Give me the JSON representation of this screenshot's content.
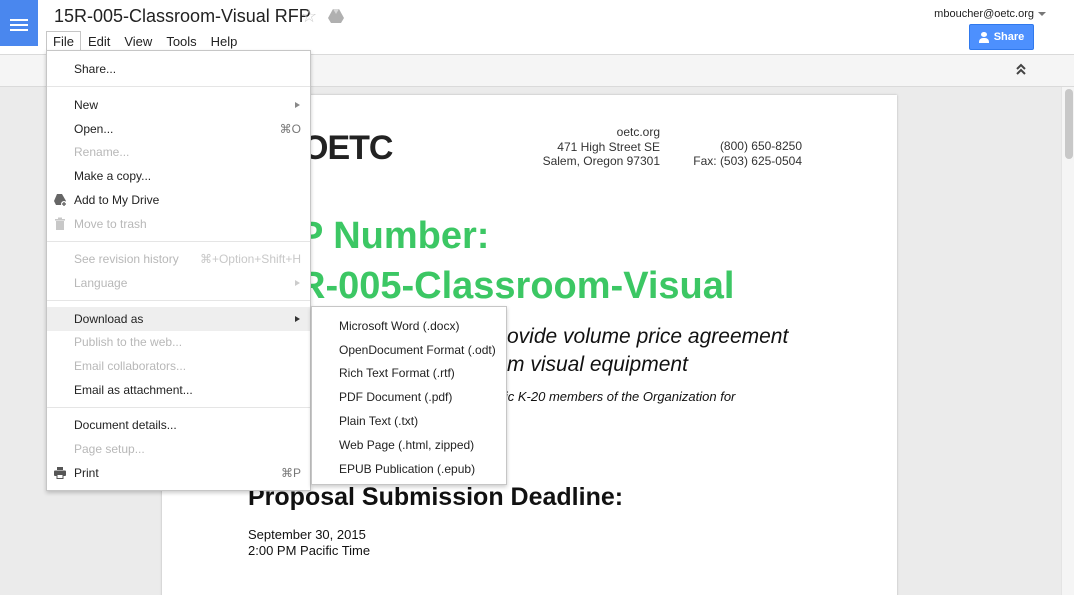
{
  "app": {
    "doc_title": "15R-005-Classroom-Visual RFP",
    "user_email": "mboucher@oetc.org",
    "share_label": "Share",
    "menubar": [
      "File",
      "Edit",
      "View",
      "Tools",
      "Help"
    ],
    "active_menu": "File"
  },
  "file_menu": {
    "items": [
      {
        "label": "Share...",
        "shortcut": "",
        "disabled": false,
        "submenu": false
      },
      {
        "label": "New",
        "shortcut": "",
        "disabled": false,
        "submenu": true
      },
      {
        "label": "Open...",
        "shortcut": "⌘O",
        "disabled": false,
        "submenu": false
      },
      {
        "label": "Rename...",
        "shortcut": "",
        "disabled": true,
        "submenu": false
      },
      {
        "label": "Make a copy...",
        "shortcut": "",
        "disabled": false,
        "submenu": false
      },
      {
        "label": "Add to My Drive",
        "shortcut": "",
        "disabled": false,
        "submenu": false,
        "icon": "drive-add-icon"
      },
      {
        "label": "Move to trash",
        "shortcut": "",
        "disabled": true,
        "submenu": false,
        "icon": "trash-icon"
      },
      {
        "label": "See revision history",
        "shortcut": "⌘+Option+Shift+H",
        "disabled": true,
        "submenu": false
      },
      {
        "label": "Language",
        "shortcut": "",
        "disabled": true,
        "submenu": true
      },
      {
        "label": "Download as",
        "shortcut": "",
        "disabled": false,
        "submenu": true,
        "highlighted": true
      },
      {
        "label": "Publish to the web...",
        "shortcut": "",
        "disabled": true,
        "submenu": false
      },
      {
        "label": "Email collaborators...",
        "shortcut": "",
        "disabled": true,
        "submenu": false
      },
      {
        "label": "Email as attachment...",
        "shortcut": "",
        "disabled": false,
        "submenu": false
      },
      {
        "label": "Document details...",
        "shortcut": "",
        "disabled": false,
        "submenu": false
      },
      {
        "label": "Page setup...",
        "shortcut": "",
        "disabled": true,
        "submenu": false
      },
      {
        "label": "Print",
        "shortcut": "⌘P",
        "disabled": false,
        "submenu": false,
        "icon": "print-icon"
      }
    ]
  },
  "download_submenu": {
    "items": [
      "Microsoft Word (.docx)",
      "OpenDocument Format (.odt)",
      "Rich Text Format (.rtf)",
      "PDF Document (.pdf)",
      "Plain Text (.txt)",
      "Web Page (.html, zipped)",
      "EPUB Publication (.epub)"
    ]
  },
  "document": {
    "logo": "OETC",
    "address_left": [
      "oetc.org",
      "471 High Street SE",
      "Salem, Oregon 97301"
    ],
    "address_right": [
      "(800) 650-8250",
      "Fax:  (503) 625-0504"
    ],
    "rfp_line1": "P Number:",
    "rfp_line2": "R-005-Classroom-Visual",
    "subtitle_line1": "ovide volume price agreement",
    "subtitle_line2": "m visual equipment",
    "small_line": "lic K-20 members of the Organization for",
    "deadline_heading": "Proposal Submission Deadline:",
    "deadline_date": "September 30, 2015",
    "deadline_time": "2:00 PM Pacific Time"
  },
  "colors": {
    "accent_blue": "#4d90fe",
    "docs_blue": "#4a87ee",
    "rfp_green": "#3cc764"
  }
}
